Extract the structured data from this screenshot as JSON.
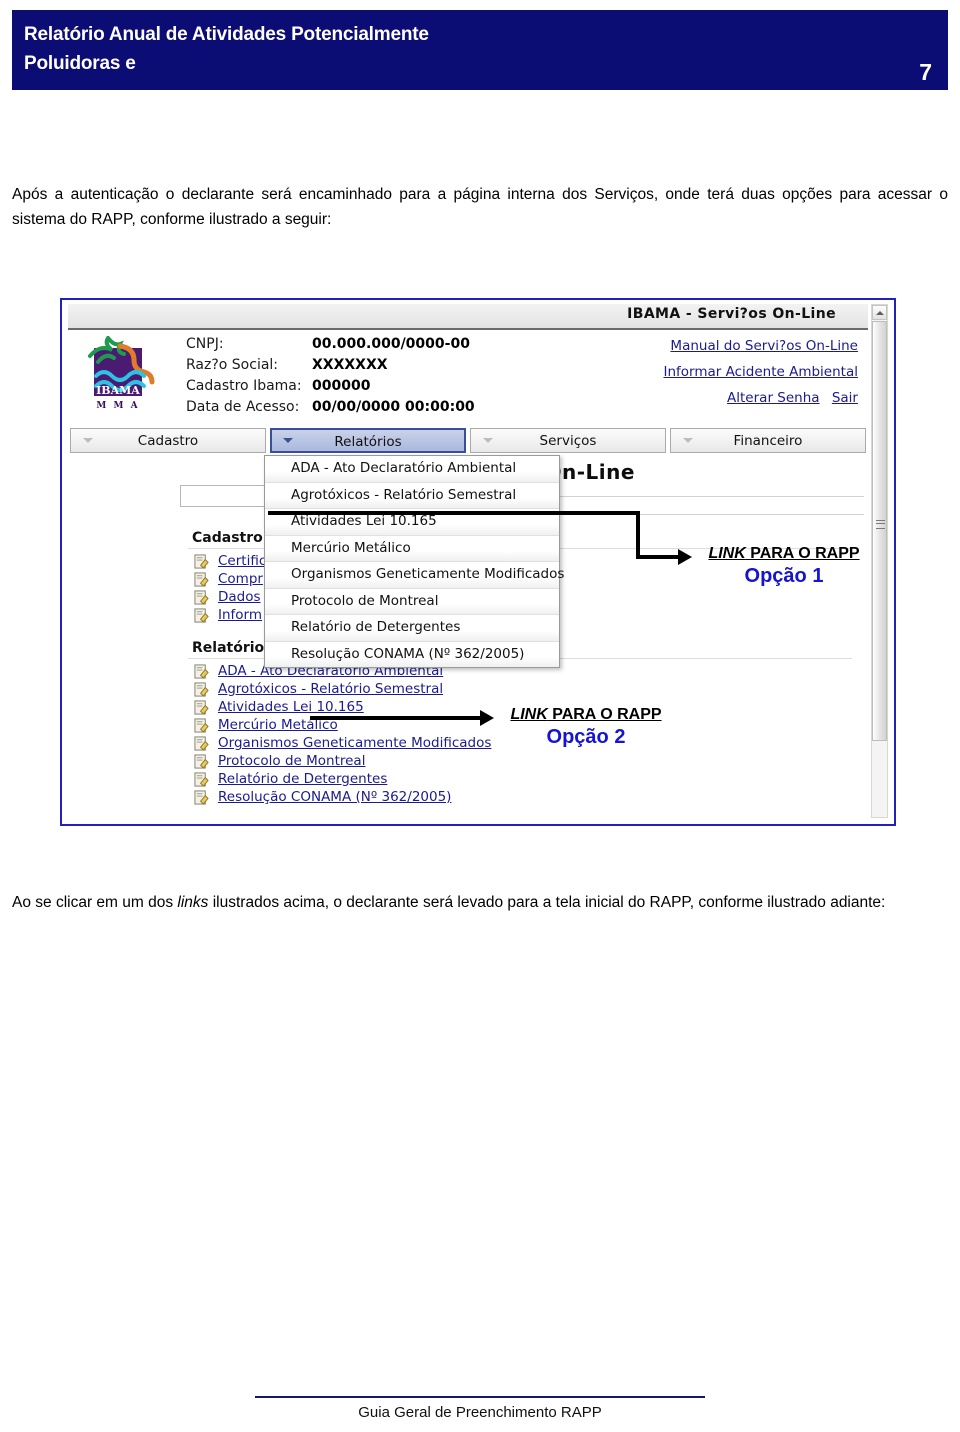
{
  "header": {
    "title_line1": "Relatório Anual de Atividades Potencialmente",
    "title_line2": "Poluidoras e",
    "page_number": "7",
    "band_color": "#0c0c75"
  },
  "body": {
    "intro_part1": "Após a autenticação o declarante será encaminhado para a página interna dos Serviços, onde terá duas opções para acessar o sistema do RAPP, conforme ilustrado a seguir:",
    "outro_part1": "Ao se clicar em um dos ",
    "outro_italic": "links",
    "outro_part2": " ilustrados acima, o declarante será levado para a tela inicial do RAPP, conforme ilustrado adiante:"
  },
  "screenshot": {
    "titlebar": "IBAMA - Servi?os On-Line",
    "banner": "AMA - Servi?os On-Line",
    "logo_name": "IBAMA",
    "logo_sub": "M M A",
    "account": [
      {
        "label": "CNPJ:",
        "value": "00.000.000/0000-00"
      },
      {
        "label": "Raz?o Social:",
        "value": "XXXXXXX"
      },
      {
        "label": "Cadastro Ibama:",
        "value": "000000"
      },
      {
        "label": "Data de Acesso:",
        "value": "00/00/0000  00:00:00"
      }
    ],
    "top_links": [
      "Manual do Servi?os On-Line",
      "Informar Acidente Ambiental",
      "Alterar Senha",
      "Sair"
    ],
    "tabs": [
      {
        "label": "Cadastro",
        "active": false
      },
      {
        "label": "Relatórios",
        "active": true
      },
      {
        "label": "Serviços",
        "active": false
      },
      {
        "label": "Financeiro",
        "active": false
      }
    ],
    "dropdown_items": [
      "ADA - Ato Declaratório Ambiental",
      "Agrotóxicos - Relatório Semestral",
      "Atividades Lei 10.165",
      "Mercúrio Metálico",
      "Organismos Geneticamente Modificados",
      "Protocolo de Montreal",
      "Relatório de Detergentes",
      "Resolução CONAMA (Nº 362/2005)"
    ],
    "cadastro": {
      "heading": "Cadastro",
      "items": [
        "Certific",
        "Compr",
        "Dados",
        "Inform"
      ]
    },
    "relatorios": {
      "heading": "Relatórios",
      "items": [
        "ADA - Ato Declaratório Ambiental",
        "Agrotóxicos - Relatório Semestral",
        "Atividades Lei 10.165",
        "Mercúrio Metálico",
        "Organismos Geneticamente Modificados",
        "Protocolo de Montreal",
        "Relatório de Detergentes",
        "Resolução CONAMA (Nº 362/2005)"
      ]
    },
    "annotations": [
      {
        "link_italic": "LINK",
        "link_rest": " PARA O RAPP",
        "option": "Opção 1"
      },
      {
        "link_italic": "LINK",
        "link_rest": " PARA O RAPP",
        "option": "Opção 2"
      }
    ],
    "annotation_color": "#1414d2"
  },
  "footer": {
    "text": "Guia Geral de Preenchimento RAPP",
    "rule_color": "#16166e"
  }
}
